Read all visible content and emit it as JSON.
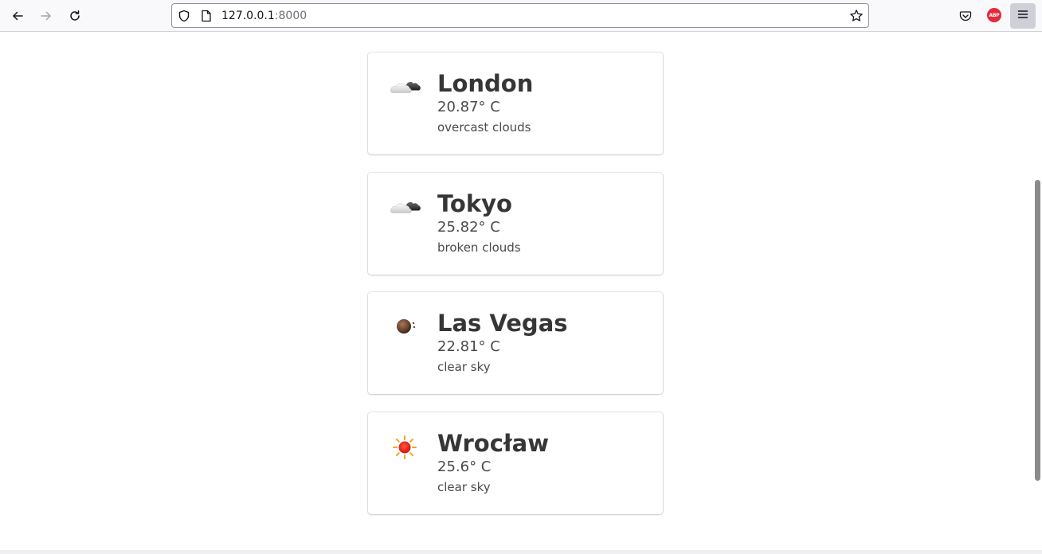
{
  "browser": {
    "url_host": "127.0.0.1",
    "url_port": ":8000",
    "icons": {
      "back": "arrow-left-icon",
      "forward": "arrow-right-icon",
      "reload": "reload-icon",
      "tracking_protection": "shield-icon",
      "page_info": "page-icon",
      "bookmark": "star-icon",
      "pocket": "pocket-icon",
      "adblock": "abp-icon",
      "menu": "hamburger-menu-icon"
    },
    "adblock_label": "ABP",
    "colors": {
      "adblock": "#e32a3a",
      "menu_active": "#cfcfd8"
    }
  },
  "cities": [
    {
      "name": "London",
      "temperature": "20.87° C",
      "description": "overcast clouds",
      "icon": "broken-clouds-icon"
    },
    {
      "name": "Tokyo",
      "temperature": "25.82° C",
      "description": "broken clouds",
      "icon": "broken-clouds-icon"
    },
    {
      "name": "Las Vegas",
      "temperature": "22.81° C",
      "description": "clear sky",
      "icon": "clear-night-icon"
    },
    {
      "name": "Wrocław",
      "temperature": "25.6° C",
      "description": "clear sky",
      "icon": "clear-day-sun-icon"
    }
  ]
}
